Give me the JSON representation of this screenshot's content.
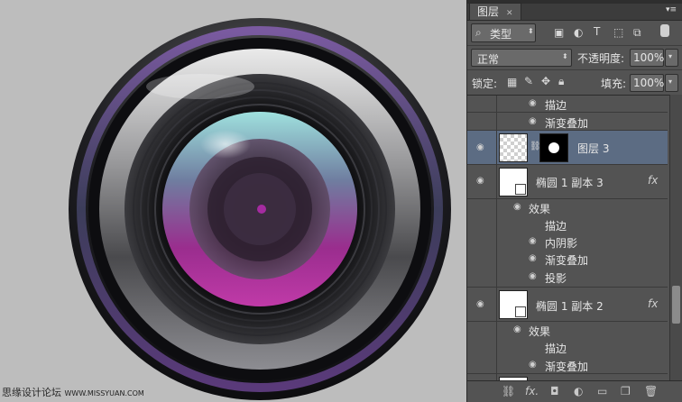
{
  "watermark": {
    "cn": "思缘设计论坛",
    "site": "WWW.MISSYUAN.COM"
  },
  "panel": {
    "tab_label": "图层",
    "tab_close": "✕",
    "menu_glyph": "▾≡",
    "filter": {
      "search_icon": "⌕",
      "value": "类型"
    },
    "blend": {
      "value": "正常",
      "opacity_label": "不透明度:",
      "opacity_value": "100%"
    },
    "lock": {
      "label": "锁定:",
      "fill_label": "填充:",
      "fill_value": "100%"
    },
    "layers": [
      {
        "type": "effect",
        "label": "描边"
      },
      {
        "type": "effect",
        "label": "渐变叠加"
      },
      {
        "type": "layer",
        "label": "图层 3",
        "selected": true
      },
      {
        "type": "layer",
        "label": "椭圆 1 副本 3",
        "fx": "fx"
      },
      {
        "type": "effects-header",
        "label": "效果"
      },
      {
        "type": "effect",
        "label": "描边"
      },
      {
        "type": "effect",
        "label": "内阴影"
      },
      {
        "type": "effect",
        "label": "渐变叠加"
      },
      {
        "type": "effect",
        "label": "投影"
      },
      {
        "type": "layer",
        "label": "椭圆 1 副本 2",
        "fx": "fx"
      },
      {
        "type": "effects-header",
        "label": "效果"
      },
      {
        "type": "effect",
        "label": "描边"
      },
      {
        "type": "effect",
        "label": "渐变叠加"
      }
    ],
    "footer_icons": [
      "link-icon",
      "fx-icon",
      "mask-icon",
      "adjustment-icon",
      "folder-icon",
      "new-layer-icon",
      "trash-icon"
    ],
    "footer_fx": "fx."
  }
}
